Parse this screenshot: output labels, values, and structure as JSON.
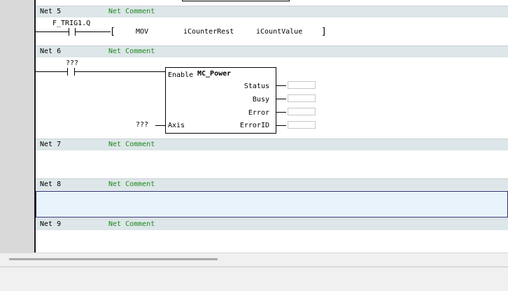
{
  "networks": [
    {
      "label": "Net 5",
      "comment": "Net Comment"
    },
    {
      "label": "Net 6",
      "comment": "Net Comment"
    },
    {
      "label": "Net 7",
      "comment": "Net Comment"
    },
    {
      "label": "Net 8",
      "comment": "Net Comment"
    },
    {
      "label": "Net 9",
      "comment": "Net Comment"
    }
  ],
  "net5": {
    "contact_label": "F_TRIG1.Q",
    "instruction": {
      "open_bracket": "[",
      "op": "MOV",
      "arg1": "iCounterRest",
      "arg2": "iCountValue",
      "close_bracket": "]"
    }
  },
  "net6": {
    "contact_label": "???",
    "block": {
      "name": "MC_Power",
      "enable_input": "Enable",
      "axis_input": "Axis",
      "outputs": [
        "Status",
        "Busy",
        "Error",
        "ErrorID"
      ]
    },
    "axis_value": "???"
  }
}
